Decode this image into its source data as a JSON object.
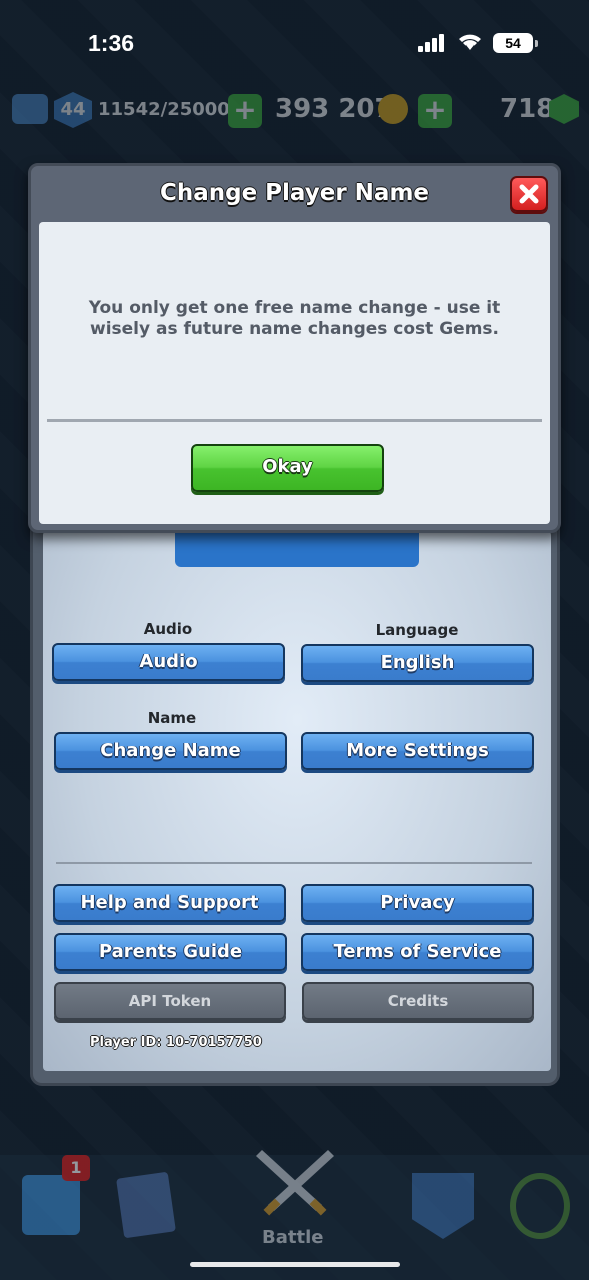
{
  "status_bar": {
    "time": "1:36",
    "battery": "54",
    "icons": [
      "signal-icon",
      "wifi-icon",
      "battery-icon"
    ]
  },
  "top_bar": {
    "level": "44",
    "xp": "11542/25000",
    "gold": "393 207",
    "gems": "718",
    "icons": [
      "crown-icon",
      "plus-icon",
      "coin-icon",
      "gem-icon"
    ]
  },
  "dialog": {
    "title": "Change Player Name",
    "message": "You only get one free name change - use it wisely as future name changes cost Gems.",
    "okay_label": "Okay",
    "close_icon": "close-icon"
  },
  "settings": {
    "audio_label": "Audio",
    "audio_button": "Audio",
    "language_label": "Language",
    "language_button": "English",
    "name_label": "Name",
    "change_name_button": "Change Name",
    "more_settings_button": "More Settings",
    "help_button": "Help and Support",
    "privacy_button": "Privacy",
    "parents_button": "Parents Guide",
    "terms_button": "Terms of Service",
    "api_button": "API Token",
    "credits_button": "Credits",
    "player_id": "Player ID: 10-70157750"
  },
  "bottom_nav": {
    "badge": "1",
    "battle_label": "Battle",
    "icons": [
      "shop-icon",
      "cards-icon",
      "battle-swords-icon",
      "clan-icon",
      "trophy-icon"
    ]
  },
  "colors": {
    "button_blue": "#4b92df",
    "button_green": "#5fd444",
    "close_red": "#d41f1f"
  }
}
